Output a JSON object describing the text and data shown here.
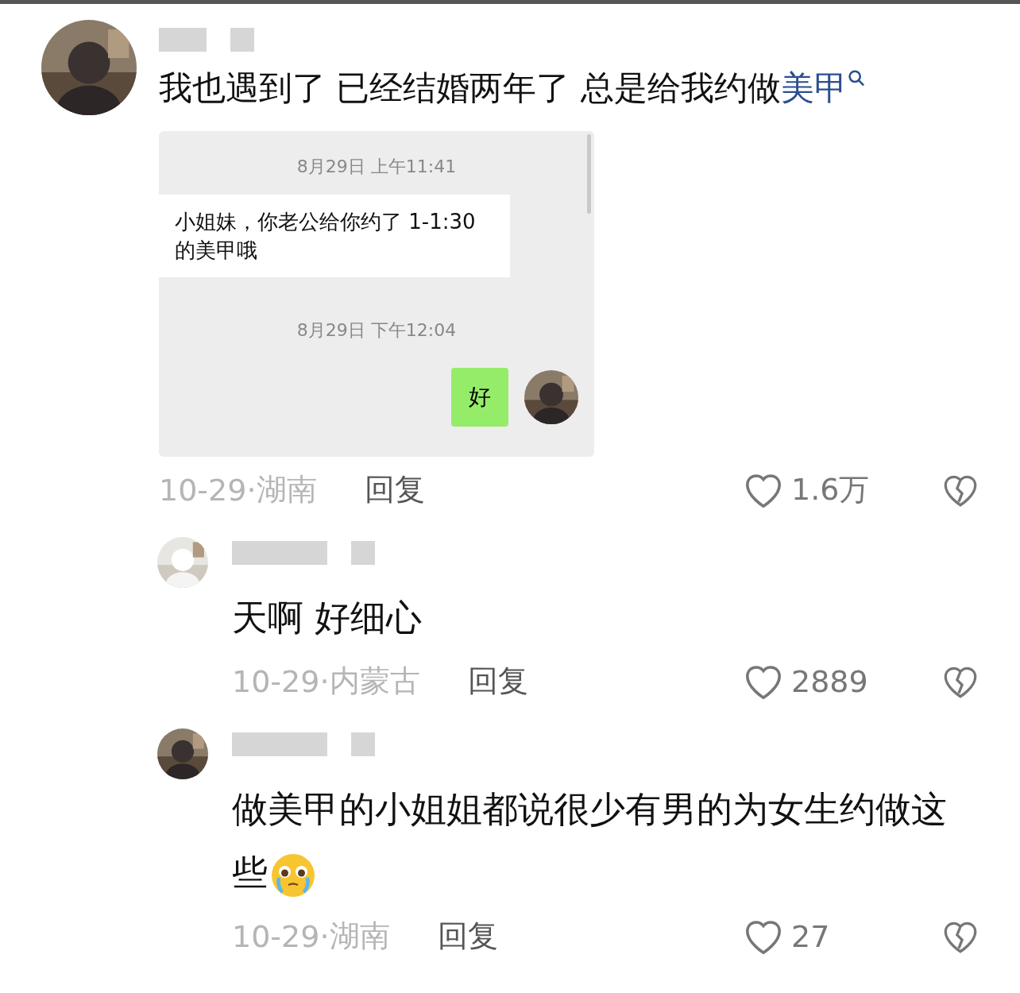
{
  "comments": [
    {
      "kind": "top",
      "text": "我也遇到了 已经结婚两年了 总是给我约做",
      "link": "美甲",
      "attachment": {
        "messages": [
          {
            "kind": "time",
            "text": "8月29日 上午11:41"
          },
          {
            "kind": "incoming",
            "text": "小姐妹，你老公给你约了 1-1:30 的美甲哦"
          },
          {
            "kind": "time",
            "text": "8月29日 下午12:04"
          },
          {
            "kind": "outgoing",
            "text": "好"
          }
        ]
      },
      "date": "10-29·",
      "location": "湖南",
      "reply": "回复",
      "likes": "1.6万"
    },
    {
      "kind": "reply",
      "text": "天啊 好细心",
      "date": "10-29·",
      "location": "内蒙古",
      "reply": "回复",
      "likes": "2889"
    },
    {
      "kind": "reply",
      "text": "做美甲的小姐姐都说很少有男的为女生约做这些",
      "emoji": true,
      "date": "10-29·",
      "location": "湖南",
      "reply": "回复",
      "likes": "27"
    }
  ]
}
